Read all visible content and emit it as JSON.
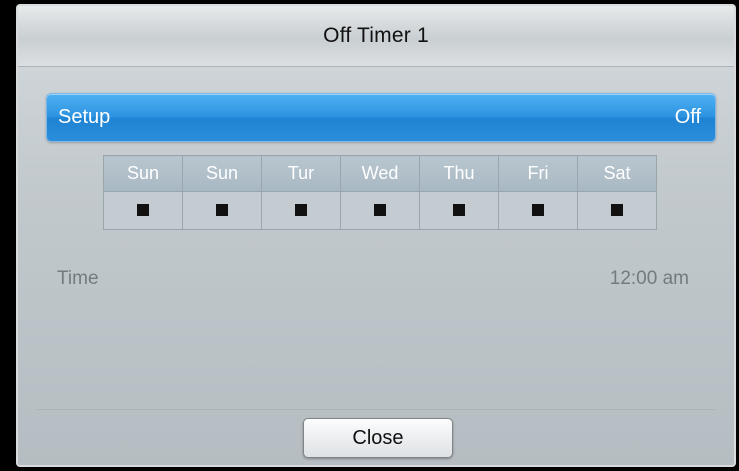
{
  "dialog": {
    "title": "Off Timer 1"
  },
  "setup": {
    "label": "Setup",
    "value": "Off"
  },
  "days": [
    {
      "label": "Sun"
    },
    {
      "label": "Sun"
    },
    {
      "label": "Tur"
    },
    {
      "label": "Wed"
    },
    {
      "label": "Thu"
    },
    {
      "label": "Fri"
    },
    {
      "label": "Sat"
    }
  ],
  "time": {
    "label": "Time",
    "value": "12:00 am"
  },
  "footer": {
    "close_label": "Close"
  }
}
